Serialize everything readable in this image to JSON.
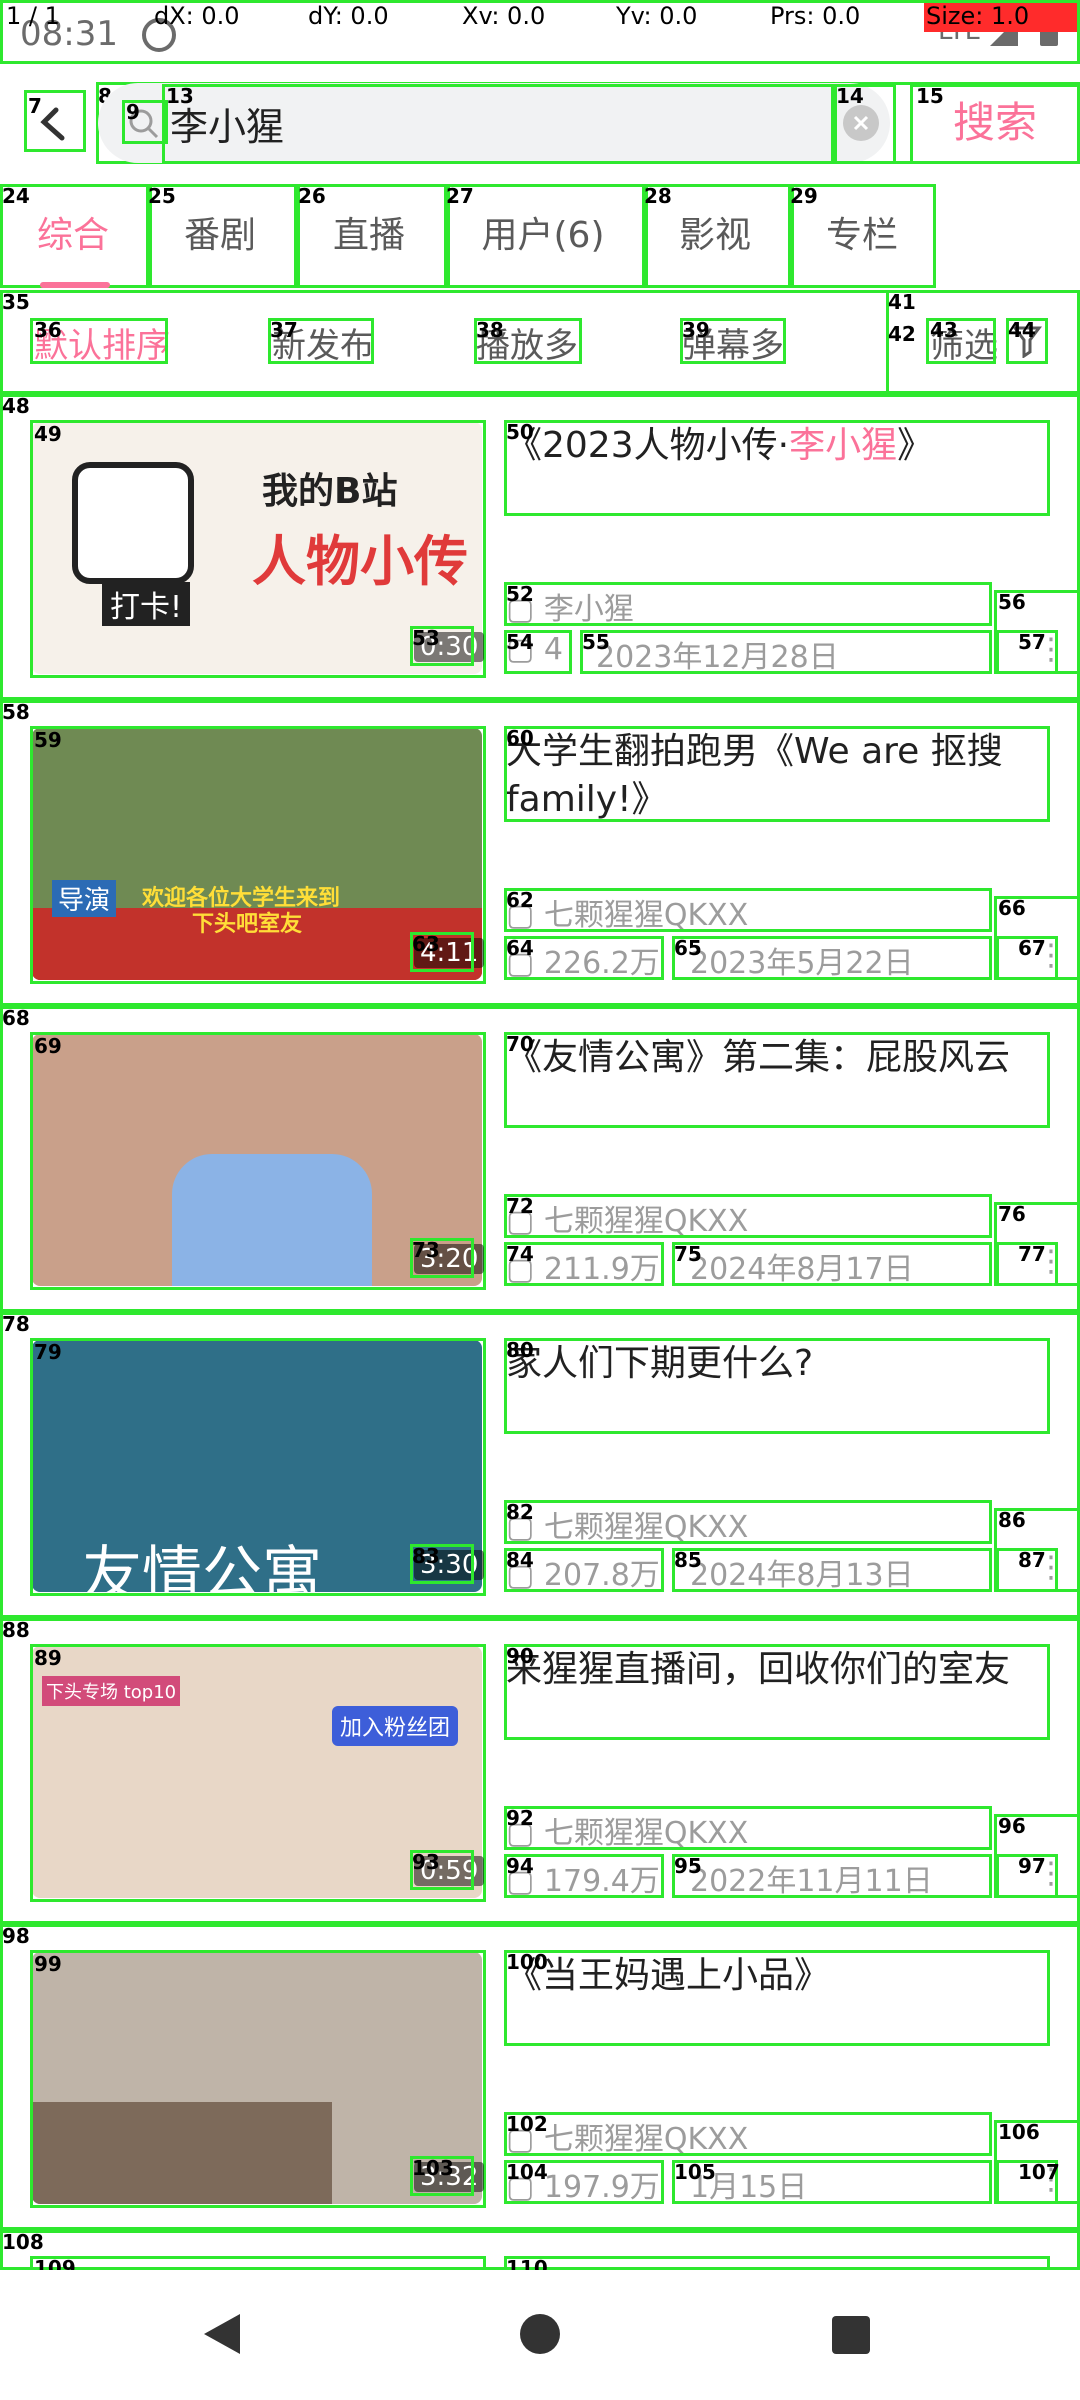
{
  "overlay": {
    "pointer": "1 / 1",
    "dx": "dX: 0.0",
    "dy": "dY: 0.0",
    "xv": "Xv: 0.0",
    "yv": "Yv: 0.0",
    "prs": "Prs: 0.0",
    "size": "Size: 1.0"
  },
  "status_bar": {
    "time": "08:31",
    "network": "LTE"
  },
  "search": {
    "query": "李小猩",
    "button_label": "搜索"
  },
  "tabs": [
    {
      "label": "综合",
      "active": true
    },
    {
      "label": "番剧"
    },
    {
      "label": "直播"
    },
    {
      "label": "用户(6)"
    },
    {
      "label": "影视"
    },
    {
      "label": "专栏"
    }
  ],
  "sort_options": [
    {
      "label": "默认排序",
      "active": true
    },
    {
      "label": "新发布"
    },
    {
      "label": "播放多"
    },
    {
      "label": "弹幕多"
    }
  ],
  "filter_label": "筛选",
  "videos": [
    {
      "title_prefix": "《2023人物小传·",
      "title_highlight": "李小猩",
      "title_suffix": "》",
      "uploader": "李小猩",
      "views": "4",
      "date": "2023年12月28日",
      "duration": "0:30",
      "thumb_caption_1": "我的B站",
      "thumb_caption_2": "人物小传",
      "thumb_caption_3": "打卡!"
    },
    {
      "title": "大学生翻拍跑男《We are 抠搜family!》",
      "uploader": "七颗猩猩QKXX",
      "views": "226.2万",
      "date": "2023年5月22日",
      "duration": "4:11",
      "thumb_caption_1": "欢迎各位大学生来到",
      "thumb_caption_2": "下头吧室友",
      "thumb_caption_3": "导演"
    },
    {
      "title": "《友情公寓》第二集：屁股风云",
      "uploader": "七颗猩猩QKXX",
      "views": "211.9万",
      "date": "2024年8月17日",
      "duration": "3:20"
    },
    {
      "title": "家人们下期更什么?",
      "uploader": "七颗猩猩QKXX",
      "views": "207.8万",
      "date": "2024年8月13日",
      "duration": "3:30",
      "thumb_caption_1": "友情公寓"
    },
    {
      "title": "来猩猩直播间，回收你们的室友",
      "uploader": "七颗猩猩QKXX",
      "views": "179.4万",
      "date": "2022年11月11日",
      "duration": "0:59",
      "thumb_caption_1": "加入粉丝团",
      "thumb_caption_2": "下头专场 top10"
    },
    {
      "title": "《当王妈遇上小品》",
      "uploader": "七颗猩猩QKXX",
      "views": "197.9万",
      "date": "1月15日",
      "duration": "3:32"
    }
  ]
}
